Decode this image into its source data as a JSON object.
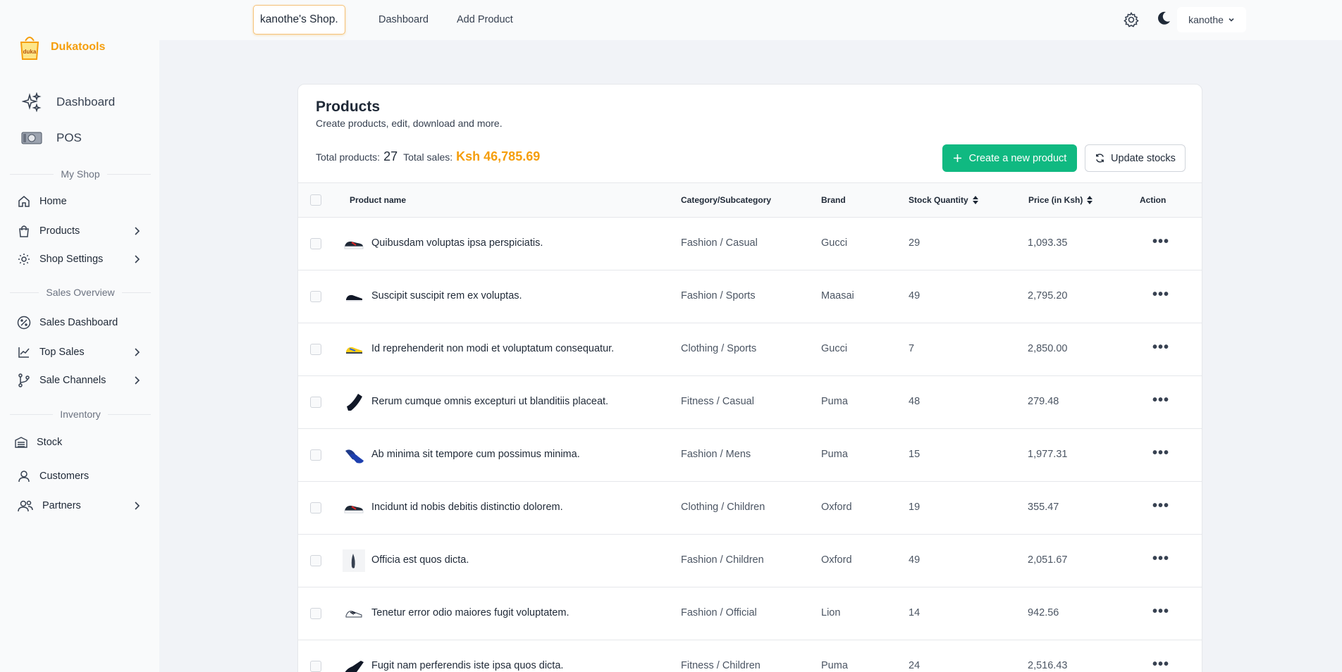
{
  "brand": {
    "name": "Dukatools",
    "logo_text": "duka"
  },
  "sidebar": {
    "primary": [
      {
        "label": "Dashboard",
        "icon": "sparkles-icon"
      },
      {
        "label": "POS",
        "icon": "cash-icon"
      }
    ],
    "sections": [
      {
        "title": "My Shop",
        "items": [
          {
            "label": "Home",
            "icon": "home-icon",
            "has_children": false
          },
          {
            "label": "Products",
            "icon": "bag-icon",
            "has_children": true
          },
          {
            "label": "Shop Settings",
            "icon": "gear-icon",
            "has_children": true
          }
        ]
      },
      {
        "title": "Sales Overview",
        "items": [
          {
            "label": "Sales Dashboard",
            "icon": "percent-badge-icon",
            "has_children": false
          },
          {
            "label": "Top Sales",
            "icon": "chart-line-icon",
            "has_children": true
          },
          {
            "label": "Sale Channels",
            "icon": "branch-icon",
            "has_children": true
          }
        ]
      },
      {
        "title": "Inventory",
        "items": [
          {
            "label": "Stock",
            "icon": "warehouse-icon",
            "has_children": false
          },
          {
            "label": "Customers",
            "icon": "user-icon",
            "has_children": false
          },
          {
            "label": "Partners",
            "icon": "users-icon",
            "has_children": true
          }
        ]
      }
    ]
  },
  "topbar": {
    "shop_name": "kanothe's Shop.",
    "links": [
      "Dashboard",
      "Add Product"
    ],
    "username": "kanothe"
  },
  "products_card": {
    "title": "Products",
    "subtitle": "Create products, edit, download and more.",
    "total_products_label": "Total products:",
    "total_products_value": "27",
    "total_sales_label": "Total sales:",
    "total_sales_value": "Ksh 46,785.69",
    "create_button": "Create a new product",
    "update_button": "Update stocks"
  },
  "table": {
    "columns": [
      "Product name",
      "Category/Subcategory",
      "Brand",
      "Stock Quantity",
      "Price (in Ksh)",
      "Action"
    ],
    "rows": [
      {
        "name": "Quibusdam voluptas ipsa perspiciatis.",
        "category": "Fashion / Casual",
        "brand": "Gucci",
        "stock": "29",
        "price": "1,093.35",
        "thumb": "sneaker-red-icon"
      },
      {
        "name": "Suscipit suscipit rem ex voluptas.",
        "category": "Fashion / Sports",
        "brand": "Maasai",
        "stock": "49",
        "price": "2,795.20",
        "thumb": "sneaker-black-icon"
      },
      {
        "name": "Id reprehenderit non modi et voluptatum consequatur.",
        "category": "Clothing / Sports",
        "brand": "Gucci",
        "stock": "7",
        "price": "2,850.00",
        "thumb": "sneaker-yellow-icon"
      },
      {
        "name": "Rerum cumque omnis excepturi ut blanditiis placeat.",
        "category": "Fitness / Casual",
        "brand": "Puma",
        "stock": "48",
        "price": "279.48",
        "thumb": "boot-black-icon"
      },
      {
        "name": "Ab minima sit tempore cum possimus minima.",
        "category": "Fashion / Mens",
        "brand": "Puma",
        "stock": "15",
        "price": "1,977.31",
        "thumb": "shoes-blue-icon"
      },
      {
        "name": "Incidunt id nobis debitis distinctio dolorem.",
        "category": "Clothing / Children",
        "brand": "Oxford",
        "stock": "19",
        "price": "355.47",
        "thumb": "sneaker-red-icon"
      },
      {
        "name": "Officia est quos dicta.",
        "category": "Fashion / Children",
        "brand": "Oxford",
        "stock": "49",
        "price": "2,051.67",
        "thumb": "shoe-dark-icon"
      },
      {
        "name": "Tenetur error odio maiores fugit voluptatem.",
        "category": "Fashion / Official",
        "brand": "Lion",
        "stock": "14",
        "price": "942.56",
        "thumb": "sneaker-white-icon"
      },
      {
        "name": "Fugit nam perferendis iste ipsa quos dicta.",
        "category": "Fitness / Children",
        "brand": "Puma",
        "stock": "24",
        "price": "2,516.43",
        "thumb": "heel-black-icon"
      }
    ]
  },
  "colors": {
    "accent": "#f59e0b",
    "primary_button": "#10b981"
  }
}
